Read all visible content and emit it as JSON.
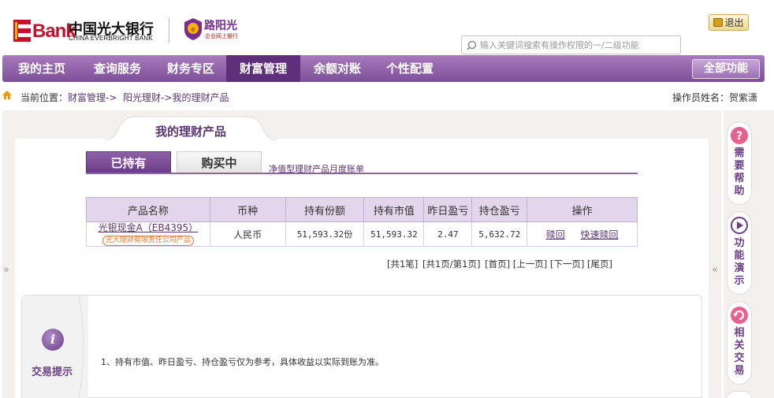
{
  "header": {
    "bank_name_cn": "中国光大银行",
    "bank_name_en": "CHINA EVERBRIGHT BANK",
    "logo_text": "Bank",
    "logo_letter": "E",
    "badge_name": "路阳光",
    "badge_sub": "企业网上银行",
    "logout_label": "退出",
    "search_placeholder": "输入关键词搜索有操作权限的一/二级功能"
  },
  "nav": {
    "items": [
      {
        "label": "我的主页"
      },
      {
        "label": "查询服务"
      },
      {
        "label": "财务专区"
      },
      {
        "label": "财富管理"
      },
      {
        "label": "余额对账"
      },
      {
        "label": "个性配置"
      }
    ],
    "all_functions_label": "全部功能"
  },
  "breadcrumb": {
    "prefix": "当前位置：",
    "items": [
      "财富管理->",
      "阳光理财->",
      "我的理财产品"
    ],
    "operator": "操作员姓名：贺紫潇"
  },
  "main_tab": {
    "label": "我的理财产品"
  },
  "sub_tabs": {
    "held": "已持有",
    "purchasing": "购买中",
    "monthly_link": "净值型理财产品月度账单"
  },
  "table": {
    "headers": [
      "产品名称",
      "币种",
      "持有份额",
      "持有市值",
      "昨日盈亏",
      "持仓盈亏",
      "操作"
    ],
    "rows": [
      {
        "product_name": "光银现金A（EB4395）",
        "issuer": "光大理财有限责任公司产品",
        "currency": "人民币",
        "shares": "51,593.32份",
        "market_value": "51,593.32",
        "yesterday_pnl": "2.47",
        "position_pnl": "5,632.72",
        "redeem": "赎回",
        "fast_redeem": "快速赎回"
      }
    ]
  },
  "pager": {
    "total": "[共1笔]",
    "pages": "[共1页/第1页]",
    "first": "[首页]",
    "prev": "[上一页]",
    "next": "[下一页]",
    "last": "[尾页]"
  },
  "side_arrows": {
    "left": "»",
    "right": "«"
  },
  "tip": {
    "icon_glyph": "i",
    "label": "交易提示",
    "text": "1、持有市值、昨日盈亏、持仓盈亏仅为参考，具体收益以实际到账为准。"
  },
  "right_panel": {
    "help": "需要帮助",
    "demo": "功能演示",
    "related": "相关交易"
  },
  "colors": {
    "brand_purple": "#7e4f98",
    "brand_red": "#c8102e",
    "link_purple": "#5a3572",
    "issuer_orange": "#e8772e"
  }
}
